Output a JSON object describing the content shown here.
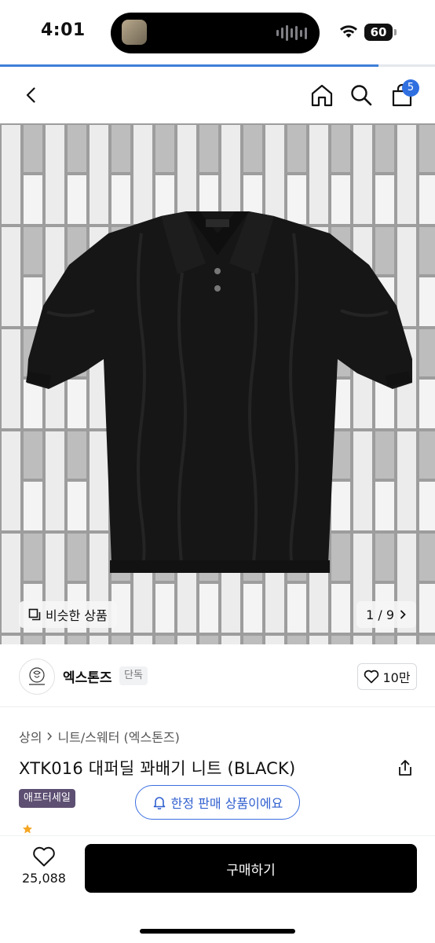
{
  "status": {
    "time": "4:01",
    "battery": "60"
  },
  "page_load_progress": 0.87,
  "nav": {
    "cart_count": "5"
  },
  "image": {
    "similar_label": "비슷한 상품",
    "counter": "1 / 9"
  },
  "brand": {
    "name": "엑스톤즈",
    "badge": "단독",
    "likes": "10만"
  },
  "breadcrumb": {
    "level1": "상의",
    "level2": "니트/스웨터 (엑스톤즈)"
  },
  "product": {
    "title": "XTK016 대퍼딜 꽈배기 니트 (BLACK)",
    "sale_tag": "애프터세일",
    "limited_label": "한정 판매 상품이에요"
  },
  "bottom": {
    "wish_count": "25,088",
    "buy_label": "구매하기"
  }
}
